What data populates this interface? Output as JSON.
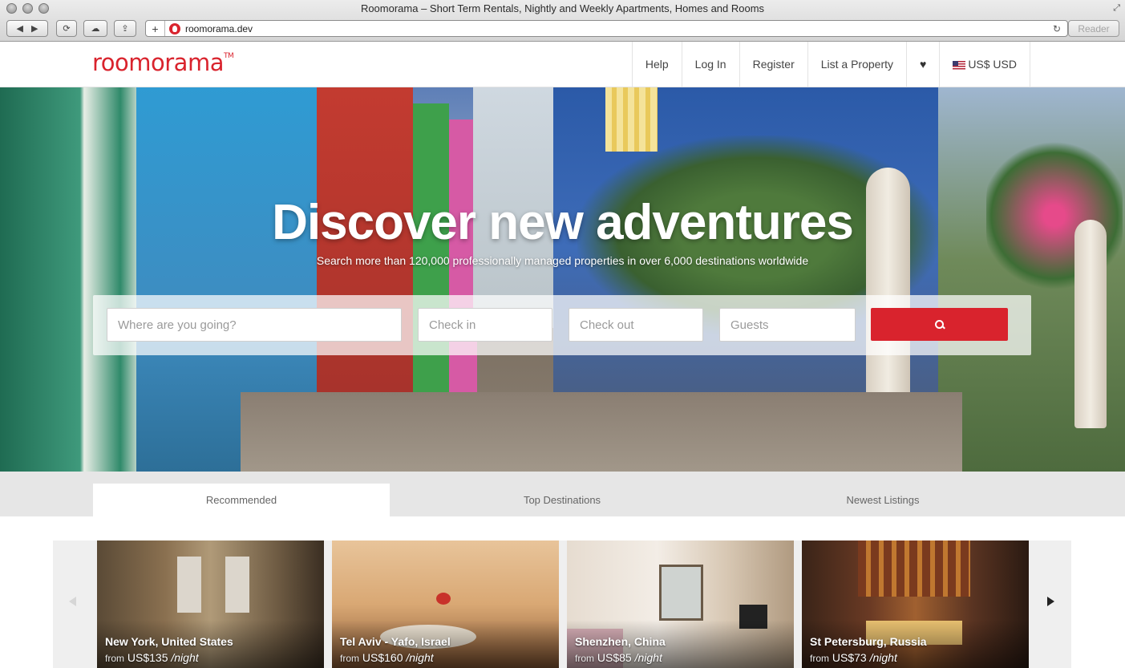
{
  "browser": {
    "window_title": "Roomorama – Short Term Rentals, Nightly and Weekly Apartments, Homes and Rooms",
    "url": "roomorama.dev",
    "reader_label": "Reader"
  },
  "header": {
    "logo": "roomorama",
    "logo_tm": "TM",
    "nav": {
      "help": "Help",
      "login": "Log In",
      "register": "Register",
      "list_property": "List a Property",
      "currency": "US$ USD"
    },
    "icons": [
      "heart-icon",
      "flag-icon"
    ]
  },
  "hero": {
    "title": "Discover new adventures",
    "subtitle": "Search more than 120,000 professionally managed properties in over 6,000 destinations worldwide",
    "search": {
      "destination_placeholder": "Where are you going?",
      "checkin_placeholder": "Check in",
      "checkout_placeholder": "Check out",
      "guests_placeholder": "Guests",
      "button_icon": "search-icon"
    }
  },
  "tabs": [
    {
      "label": "Recommended",
      "active": true
    },
    {
      "label": "Top Destinations",
      "active": false
    },
    {
      "label": "Newest Listings",
      "active": false
    }
  ],
  "listings": [
    {
      "city": "New York, United States",
      "from": "from",
      "price": "US$135",
      "per": "/night"
    },
    {
      "city": "Tel Aviv - Yafo, Israel",
      "from": "from",
      "price": "US$160",
      "per": "/night"
    },
    {
      "city": "Shenzhen, China",
      "from": "from",
      "price": "US$85",
      "per": "/night"
    },
    {
      "city": "St Petersburg, Russia",
      "from": "from",
      "price": "US$73",
      "per": "/night"
    }
  ],
  "colors": {
    "brand": "#d9232d",
    "tab_bar": "#e6e6e6"
  }
}
